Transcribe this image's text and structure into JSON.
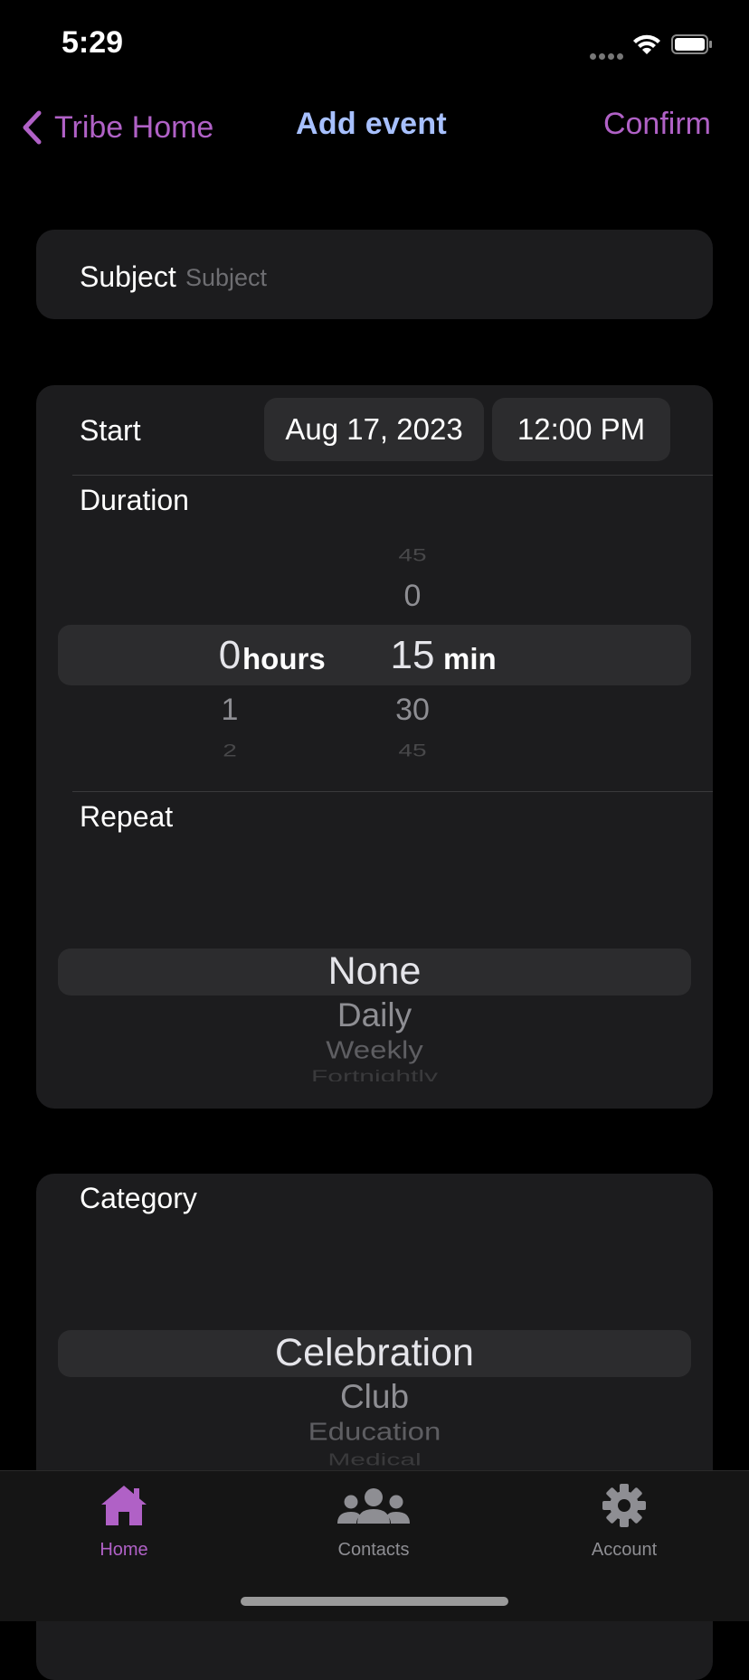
{
  "status_bar": {
    "time": "5:29"
  },
  "nav": {
    "back_label": "Tribe Home",
    "title": "Add event",
    "confirm_label": "Confirm"
  },
  "subject": {
    "label": "Subject",
    "placeholder": "Subject",
    "value": ""
  },
  "start": {
    "label": "Start",
    "date": "Aug 17, 2023",
    "time": "12:00 PM"
  },
  "duration": {
    "label": "Duration",
    "hours_selected": "0",
    "hours_unit": "hours",
    "hours_below": [
      "1",
      "2"
    ],
    "minutes_above": [
      "45",
      "0"
    ],
    "minutes_selected": "15",
    "minutes_unit": "min",
    "minutes_below": [
      "30",
      "45"
    ]
  },
  "repeat": {
    "label": "Repeat",
    "selected": "None",
    "options_below": [
      "Daily",
      "Weekly",
      "Fortnightly"
    ]
  },
  "category": {
    "label": "Category",
    "selected": "Celebration",
    "options_below": [
      "Club",
      "Education",
      "Medical"
    ]
  },
  "tabbar": {
    "items": [
      {
        "label": "Home",
        "icon": "home-icon",
        "active": true
      },
      {
        "label": "Contacts",
        "icon": "contacts-icon",
        "active": false
      },
      {
        "label": "Account",
        "icon": "gear-icon",
        "active": false
      }
    ]
  },
  "colors": {
    "accent": "#b061c6",
    "title": "#a7c0ff",
    "card": "#1c1c1e",
    "pill": "#2c2c2e"
  }
}
